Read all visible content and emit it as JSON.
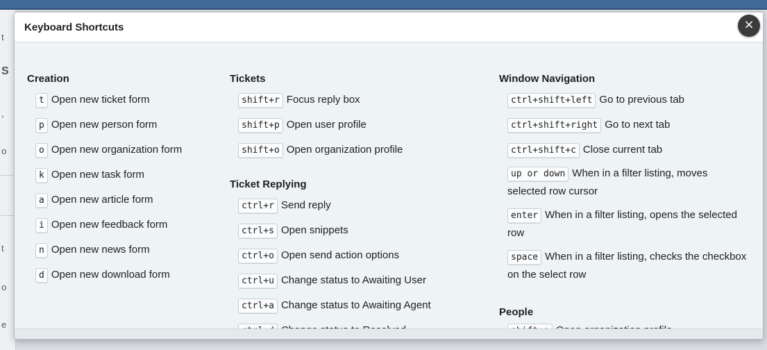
{
  "modal": {
    "title": "Keyboard Shortcuts",
    "close_label": "×"
  },
  "background": {
    "glyphs": [
      "t",
      "S",
      ",",
      "o",
      "t",
      "o",
      "e"
    ]
  },
  "columns": [
    {
      "sections": [
        {
          "title": "Creation",
          "items": [
            {
              "key": "t",
              "desc": "Open new ticket form"
            },
            {
              "key": "p",
              "desc": "Open new person form"
            },
            {
              "key": "o",
              "desc": "Open new organization form"
            },
            {
              "key": "k",
              "desc": "Open new task form"
            },
            {
              "key": "a",
              "desc": "Open new article form"
            },
            {
              "key": "i",
              "desc": "Open new feedback form"
            },
            {
              "key": "n",
              "desc": "Open new news form"
            },
            {
              "key": "d",
              "desc": "Open new download form"
            }
          ]
        }
      ]
    },
    {
      "sections": [
        {
          "title": "Tickets",
          "items": [
            {
              "key": "shift+r",
              "desc": "Focus reply box"
            },
            {
              "key": "shift+p",
              "desc": "Open user profile"
            },
            {
              "key": "shift+o",
              "desc": "Open organization profile"
            }
          ]
        },
        {
          "title": "Ticket Replying",
          "items": [
            {
              "key": "ctrl+r",
              "desc": "Send reply"
            },
            {
              "key": "ctrl+s",
              "desc": "Open snippets"
            },
            {
              "key": "ctrl+o",
              "desc": "Open send action options"
            },
            {
              "key": "ctrl+u",
              "desc": "Change status to Awaiting User"
            },
            {
              "key": "ctrl+a",
              "desc": "Change status to Awaiting Agent"
            },
            {
              "key": "ctrl+d",
              "desc": "Change status to Resolved"
            }
          ]
        }
      ]
    },
    {
      "sections": [
        {
          "title": "Window Navigation",
          "items": [
            {
              "key": "ctrl+shift+left",
              "desc": "Go to previous tab"
            },
            {
              "key": "ctrl+shift+right",
              "desc": "Go to next tab"
            },
            {
              "key": "ctrl+shift+c",
              "desc": "Close current tab"
            },
            {
              "key": "up or down",
              "desc": "When in a filter listing, moves selected row cursor"
            },
            {
              "key": "enter",
              "desc": "When in a filter listing, opens the selected row"
            },
            {
              "key": "space",
              "desc": "When in a filter listing, checks the checkbox on the select row"
            }
          ]
        },
        {
          "title": "People",
          "items": [
            {
              "key": "shift+o",
              "desc": "Open organization profile"
            }
          ]
        }
      ]
    }
  ]
}
